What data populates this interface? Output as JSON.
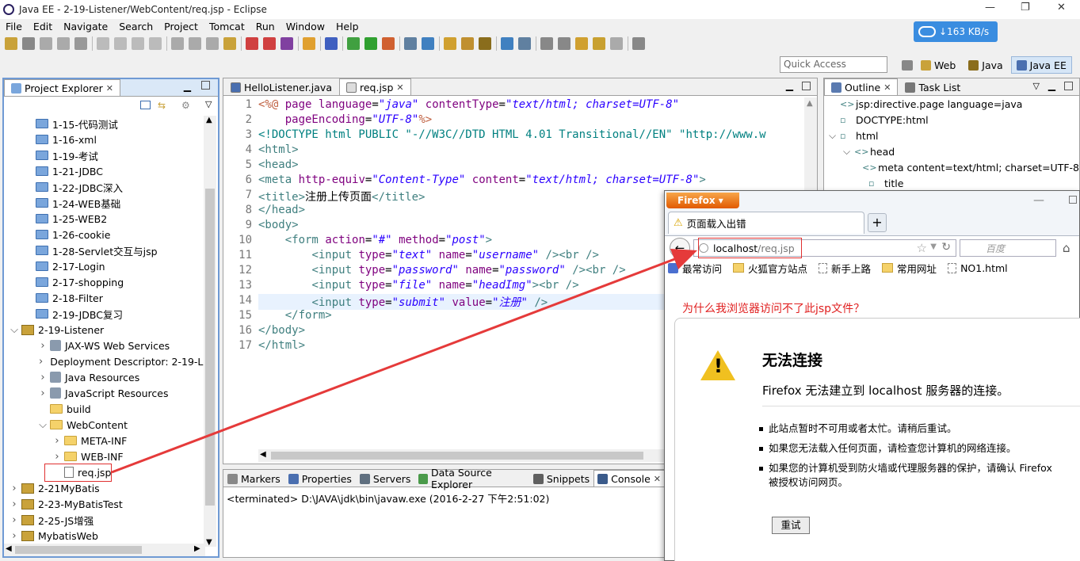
{
  "window": {
    "title": "Java EE - 2-19-Listener/WebContent/req.jsp - Eclipse",
    "min": "—",
    "max": "❐",
    "close": "✕"
  },
  "menu": [
    "File",
    "Edit",
    "Navigate",
    "Search",
    "Project",
    "Tomcat",
    "Run",
    "Window",
    "Help"
  ],
  "speed": "↓163 KB/s",
  "quick_access": "Quick Access",
  "perspectives": [
    {
      "label": "Web",
      "active": false
    },
    {
      "label": "Java",
      "active": false
    },
    {
      "label": "Java EE",
      "active": true
    }
  ],
  "project_explorer": {
    "tab": "Project Explorer",
    "items": [
      {
        "label": "1-15-代码测试",
        "icon": "folder-icon",
        "indent": 1,
        "tw": ""
      },
      {
        "label": "1-16-xml",
        "icon": "folder-icon",
        "indent": 1,
        "tw": ""
      },
      {
        "label": "1-19-考试",
        "icon": "folder-icon",
        "indent": 1,
        "tw": ""
      },
      {
        "label": "1-21-JDBC",
        "icon": "folder-icon",
        "indent": 1,
        "tw": ""
      },
      {
        "label": "1-22-JDBC深入",
        "icon": "folder-icon",
        "indent": 1,
        "tw": ""
      },
      {
        "label": "1-24-WEB基础",
        "icon": "folder-icon",
        "indent": 1,
        "tw": ""
      },
      {
        "label": "1-25-WEB2",
        "icon": "folder-icon",
        "indent": 1,
        "tw": ""
      },
      {
        "label": "1-26-cookie",
        "icon": "folder-icon",
        "indent": 1,
        "tw": ""
      },
      {
        "label": "1-28-Servlet交互与jsp",
        "icon": "folder-icon",
        "indent": 1,
        "tw": ""
      },
      {
        "label": "2-17-Login",
        "icon": "folder-icon",
        "indent": 1,
        "tw": ""
      },
      {
        "label": "2-17-shopping",
        "icon": "folder-icon",
        "indent": 1,
        "tw": ""
      },
      {
        "label": "2-18-Filter",
        "icon": "folder-icon",
        "indent": 1,
        "tw": ""
      },
      {
        "label": "2-19-JDBC复习",
        "icon": "folder-icon",
        "indent": 1,
        "tw": ""
      },
      {
        "label": "2-19-Listener",
        "icon": "project-icon",
        "indent": 0,
        "tw": "v"
      },
      {
        "label": "JAX-WS Web Services",
        "icon": "gear-icon",
        "indent": 2,
        "tw": ">"
      },
      {
        "label": "Deployment Descriptor: 2-19-List",
        "icon": "gear-icon",
        "indent": 2,
        "tw": ">"
      },
      {
        "label": "Java Resources",
        "icon": "gear-icon",
        "indent": 2,
        "tw": ">"
      },
      {
        "label": "JavaScript Resources",
        "icon": "gear-icon",
        "indent": 2,
        "tw": ">"
      },
      {
        "label": "build",
        "icon": "yfolder-icon",
        "indent": 2,
        "tw": ""
      },
      {
        "label": "WebContent",
        "icon": "yfolder-icon",
        "indent": 2,
        "tw": "v"
      },
      {
        "label": "META-INF",
        "icon": "yfolder-icon",
        "indent": 3,
        "tw": ">"
      },
      {
        "label": "WEB-INF",
        "icon": "yfolder-icon",
        "indent": 3,
        "tw": ">"
      },
      {
        "label": "req.jsp",
        "icon": "file-icon",
        "indent": 3,
        "tw": ""
      },
      {
        "label": "2-21MyBatis",
        "icon": "project-icon",
        "indent": 0,
        "tw": ">"
      },
      {
        "label": "2-23-MyBatisTest",
        "icon": "project-icon",
        "indent": 0,
        "tw": ">"
      },
      {
        "label": "2-25-JS增强",
        "icon": "project-icon",
        "indent": 0,
        "tw": ">"
      },
      {
        "label": "MybatisWeb",
        "icon": "project-icon",
        "indent": 0,
        "tw": ">"
      }
    ]
  },
  "editor": {
    "tabs": [
      {
        "label": "HelloListener.java",
        "active": false
      },
      {
        "label": "req.jsp",
        "active": true
      }
    ],
    "lines": [
      {
        "n": "1",
        "html": "<span class=\"dir\">&lt;%@</span> <span class=\"att\">page</span> <span class=\"att\">language</span>=<span class=\"val\">\"java\"</span> <span class=\"att\">contentType</span>=<span class=\"val\">\"text/html; charset=UTF-8\"</span>"
      },
      {
        "n": "2",
        "html": "    <span class=\"att\">pageEncoding</span>=<span class=\"val\">\"UTF-8\"</span><span class=\"dir\">%&gt;</span>"
      },
      {
        "n": "3",
        "html": "<span class=\"doc\">&lt;!DOCTYPE html PUBLIC \"-//W3C//DTD HTML 4.01 Transitional//EN\" \"http://www.w</span>"
      },
      {
        "n": "4",
        "html": "<span class=\"tag\">&lt;html&gt;</span>"
      },
      {
        "n": "5",
        "html": "<span class=\"tag\">&lt;head&gt;</span>"
      },
      {
        "n": "6",
        "html": "<span class=\"tag\">&lt;meta</span> <span class=\"att\">http-equiv</span>=<span class=\"val\">\"Content-Type\"</span> <span class=\"att\">content</span>=<span class=\"val\">\"text/html; charset=UTF-8\"</span><span class=\"tag\">&gt;</span>"
      },
      {
        "n": "7",
        "html": "<span class=\"tag\">&lt;title&gt;</span>注册上传页面<span class=\"tag\">&lt;/title&gt;</span>"
      },
      {
        "n": "8",
        "html": "<span class=\"tag\">&lt;/head&gt;</span>"
      },
      {
        "n": "9",
        "html": "<span class=\"tag\">&lt;body&gt;</span>"
      },
      {
        "n": "10",
        "html": "    <span class=\"tag\">&lt;form</span> <span class=\"att\">action</span>=<span class=\"val\">\"#\"</span> <span class=\"att\">method</span>=<span class=\"val\">\"post\"</span><span class=\"tag\">&gt;</span>"
      },
      {
        "n": "11",
        "html": "        <span class=\"tag\">&lt;input</span> <span class=\"att\">type</span>=<span class=\"val\">\"text\"</span> <span class=\"att\">name</span>=<span class=\"val\">\"username\"</span> <span class=\"tag\">/&gt;&lt;br /&gt;</span>"
      },
      {
        "n": "12",
        "html": "        <span class=\"tag\">&lt;input</span> <span class=\"att\">type</span>=<span class=\"val\">\"password\"</span> <span class=\"att\">name</span>=<span class=\"val\">\"password\"</span> <span class=\"tag\">/&gt;&lt;br /&gt;</span>"
      },
      {
        "n": "13",
        "html": "        <span class=\"tag\">&lt;input</span> <span class=\"att\">type</span>=<span class=\"val\">\"file\"</span> <span class=\"att\">name</span>=<span class=\"val\">\"headImg\"</span><span class=\"tag\">&gt;&lt;br /&gt;</span>"
      },
      {
        "n": "14",
        "html": "        <span class=\"tag\">&lt;input</span> <span class=\"att\">type</span>=<span class=\"val\">\"submit\"</span> <span class=\"att\">value</span>=<span class=\"val\">\"注册\"</span> <span class=\"tag\">/&gt;</span>"
      },
      {
        "n": "15",
        "html": "    <span class=\"tag\">&lt;/form&gt;</span>"
      },
      {
        "n": "16",
        "html": "<span class=\"tag\">&lt;/body&gt;</span>"
      },
      {
        "n": "17",
        "html": "<span class=\"tag\">&lt;/html&gt;</span>"
      }
    ]
  },
  "console": {
    "tabs": [
      "Markers",
      "Properties",
      "Servers",
      "Data Source Explorer",
      "Snippets",
      "Console"
    ],
    "status": "<terminated> D:\\JAVA\\jdk\\bin\\javaw.exe (2016-2-27 下午2:51:02)"
  },
  "outline": {
    "tabs": [
      "Outline",
      "Task List"
    ],
    "items": [
      {
        "label": "jsp:directive.page language=java",
        "indent": 1,
        "tw": "",
        "icon": "<>"
      },
      {
        "label": "DOCTYPE:html",
        "indent": 1,
        "tw": "",
        "icon": "D"
      },
      {
        "label": "html",
        "indent": 1,
        "tw": "v",
        "icon": "h"
      },
      {
        "label": "head",
        "indent": 2,
        "tw": "v",
        "icon": "<>"
      },
      {
        "label": "meta content=text/html; charset=UTF-8",
        "indent": 3,
        "tw": "",
        "icon": "<>"
      },
      {
        "label": "title",
        "indent": 3,
        "tw": "",
        "icon": "t"
      }
    ]
  },
  "firefox": {
    "button": "Firefox ▾",
    "tab_title": "页面载入出错",
    "url_host": "localhost",
    "url_path": "/req.jsp",
    "search_placeholder": "百度",
    "bookmarks": [
      {
        "label": "最常访问",
        "icon": "bookmark-star-icon"
      },
      {
        "label": "火狐官方站点",
        "icon": "folder-icon"
      },
      {
        "label": "新手上路",
        "icon": "page-icon"
      },
      {
        "label": "常用网址",
        "icon": "folder-icon"
      },
      {
        "label": "NO1.html",
        "icon": "page-icon"
      }
    ],
    "question": "为什么我浏览器访问不了此jsp文件？",
    "error_title": "无法连接",
    "error_sub": "Firefox 无法建立到 localhost 服务器的连接。",
    "bullets": [
      "此站点暂时不可用或者太忙。请稍后重试。",
      "如果您无法载入任何页面，请检查您计算机的网络连接。",
      "如果您的计算机受到防火墙或代理服务器的保护，请确认 Firefox 被授权访问网页。"
    ],
    "retry": "重试"
  },
  "colors": {
    "accent": "#6f9ad4",
    "annotation": "#e03030",
    "firefox_orange": "#e66000"
  }
}
